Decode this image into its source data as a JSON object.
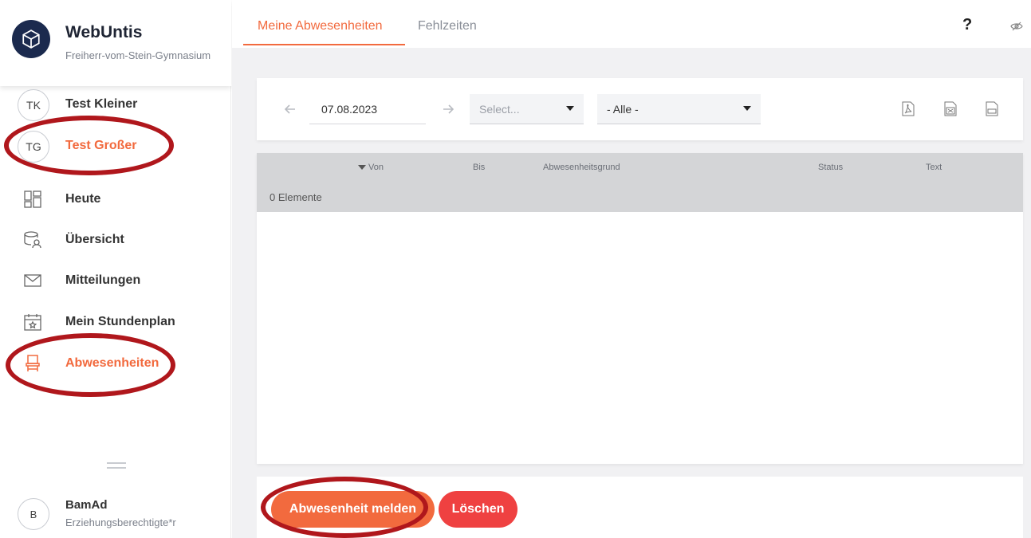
{
  "brand": {
    "title": "WebUntis",
    "school": "Freiherr-vom-Stein-Gymnasium"
  },
  "sidebar": {
    "items": [
      {
        "initials": "TK",
        "label": "Test Kleiner"
      },
      {
        "initials": "TG",
        "label": "Test Großer"
      },
      {
        "icon": "dashboard-icon",
        "label": "Heute"
      },
      {
        "icon": "overview-icon",
        "label": "Übersicht"
      },
      {
        "icon": "mail-icon",
        "label": "Mitteilungen"
      },
      {
        "icon": "calendar-icon",
        "label": "Mein Stundenplan"
      },
      {
        "icon": "chair-icon",
        "label": "Abwesenheiten"
      }
    ],
    "user": {
      "initials": "B",
      "name": "BamAd",
      "role": "Erziehungsberechtigte*r"
    }
  },
  "tabs": [
    {
      "label": "Meine Abwesenheiten"
    },
    {
      "label": "Fehlzeiten"
    }
  ],
  "toolbar": {
    "help": "?"
  },
  "filter": {
    "date": "07.08.2023",
    "select_placeholder": "Select...",
    "status_value": "- Alle -"
  },
  "table": {
    "columns": [
      "Von",
      "Bis",
      "Abwesenheitsgrund",
      "Status",
      "Text"
    ],
    "count_text": "0 Elemente"
  },
  "actions": {
    "report": "Abwesenheit melden",
    "delete": "Löschen"
  },
  "colors": {
    "accent": "#f26a3e",
    "danger": "#ef4141",
    "annotation": "#b0171c",
    "brand_dark": "#1b2a4e"
  }
}
